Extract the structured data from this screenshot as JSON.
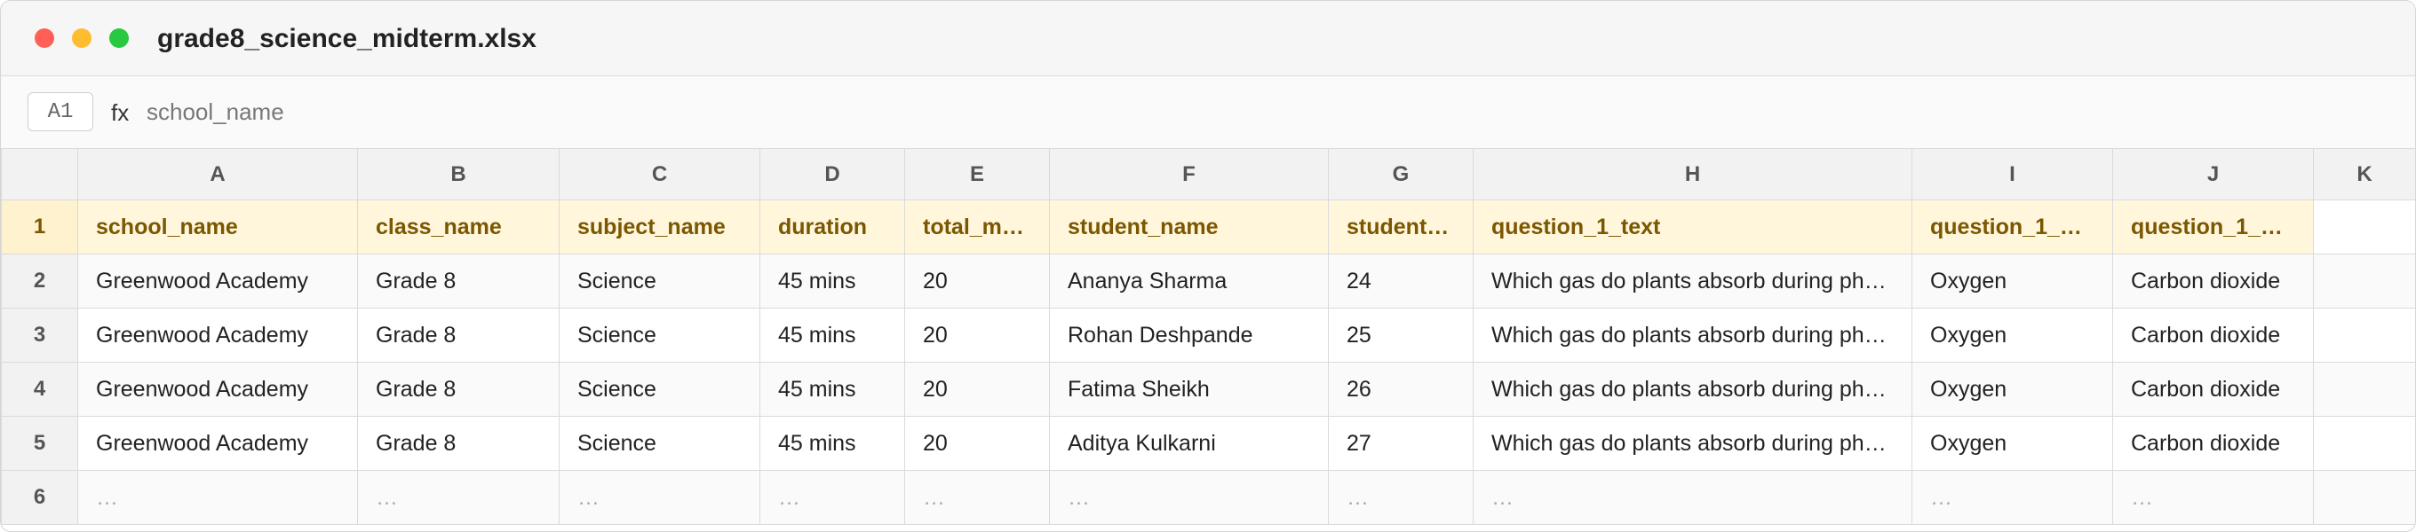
{
  "window": {
    "title": "grade8_science_midterm.xlsx",
    "traffic_colors": {
      "close": "#ff5f57",
      "minimize": "#febc2e",
      "zoom": "#28c840"
    }
  },
  "formula_bar": {
    "cell_ref": "A1",
    "fx_label": "fx",
    "value": "school_name"
  },
  "grid": {
    "columns": [
      "A",
      "B",
      "C",
      "D",
      "E",
      "F",
      "G",
      "H",
      "I",
      "J",
      "K"
    ],
    "header_row": {
      "number": "1",
      "cells": [
        "school_name",
        "class_name",
        "subject_name",
        "duration",
        "total_m…",
        "student_name",
        "student…",
        "question_1_text",
        "question_1_…",
        "question_1_…",
        ""
      ]
    },
    "rows": [
      {
        "number": "2",
        "cells": [
          "Greenwood Academy",
          "Grade 8",
          "Science",
          "45 mins",
          "20",
          "Ananya Sharma",
          "24",
          "Which gas do plants absorb during ph…",
          "Oxygen",
          "Carbon dioxide",
          ""
        ]
      },
      {
        "number": "3",
        "cells": [
          "Greenwood Academy",
          "Grade 8",
          "Science",
          "45 mins",
          "20",
          "Rohan Deshpande",
          "25",
          "Which gas do plants absorb during ph…",
          "Oxygen",
          "Carbon dioxide",
          ""
        ]
      },
      {
        "number": "4",
        "cells": [
          "Greenwood Academy",
          "Grade 8",
          "Science",
          "45 mins",
          "20",
          "Fatima Sheikh",
          "26",
          "Which gas do plants absorb during ph…",
          "Oxygen",
          "Carbon dioxide",
          ""
        ]
      },
      {
        "number": "5",
        "cells": [
          "Greenwood Academy",
          "Grade 8",
          "Science",
          "45 mins",
          "20",
          "Aditya Kulkarni",
          "27",
          "Which gas do plants absorb during ph…",
          "Oxygen",
          "Carbon dioxide",
          ""
        ]
      }
    ],
    "ellipsis_row": {
      "number": "6",
      "cells": [
        "…",
        "…",
        "…",
        "…",
        "…",
        "…",
        "…",
        "…",
        "…",
        "…",
        ""
      ]
    }
  }
}
